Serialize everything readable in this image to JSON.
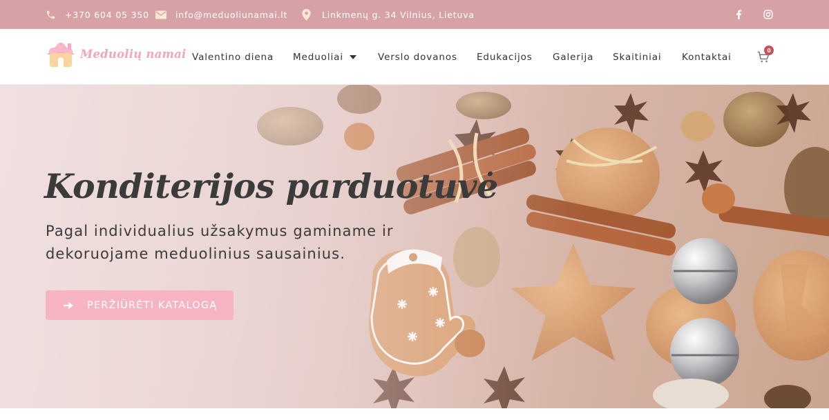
{
  "topbar": {
    "phone": "+370 604 05 350",
    "email": "info@meduoliunamai.lt",
    "address": "Linkmenų g. 34 Vilnius, Lietuva",
    "icons": [
      "phone-icon",
      "envelope-icon",
      "map-pin-icon",
      "facebook-icon",
      "instagram-icon"
    ],
    "color": "#d7a2a6"
  },
  "header": {
    "logo_text": "Meduolių namai",
    "nav": [
      {
        "label": "Valentino diena"
      },
      {
        "label": "Meduoliai",
        "has_dropdown": true
      },
      {
        "label": "Verslo dovanos"
      },
      {
        "label": "Edukacijos"
      },
      {
        "label": "Galerija"
      },
      {
        "label": "Skaitiniai"
      },
      {
        "label": "Kontaktai"
      }
    ],
    "cart_count": "0"
  },
  "hero": {
    "title": "Konditerijos parduotuvė",
    "subtitle": "Pagal individualius užsakymus gaminame ir dekoruojame meduolinius sausainius.",
    "button_label": "PERŽIŪRĖTI KATALOGĄ",
    "button_color": "#f7b5c3"
  },
  "colors": {
    "accent": "#f7b5c3",
    "topbar": "#d7a2a6",
    "text_dark": "#3b3b3b",
    "badge": "#c8505a"
  }
}
